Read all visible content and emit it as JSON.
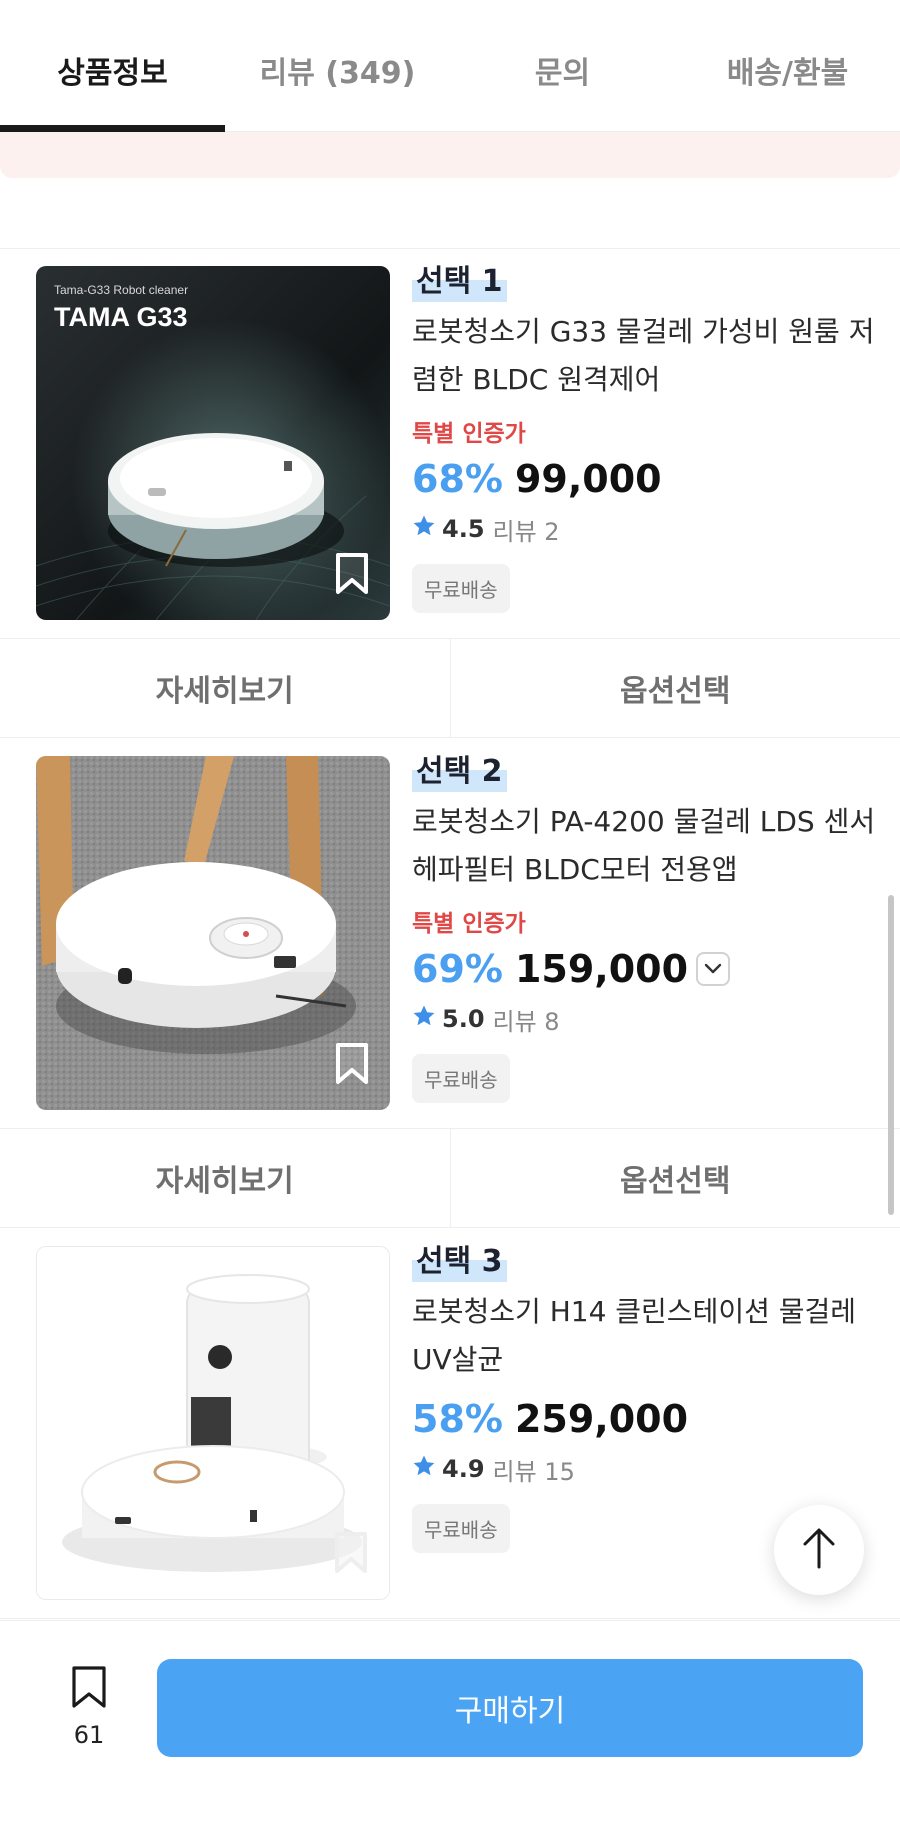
{
  "tabs": [
    {
      "label": "상품정보"
    },
    {
      "label": "리뷰 (349)"
    },
    {
      "label": "문의"
    },
    {
      "label": "배송/환불"
    }
  ],
  "products": [
    {
      "choice": "선택 1",
      "title": "로봇청소기 G33 물걸레 가성비 원룸 저렴한 BLDC 원격제어",
      "special": "특별 인증가",
      "discount": "68%",
      "price": "99,000",
      "rating": "4.5",
      "reviews": "리뷰 2",
      "badge": "무료배송",
      "image": {
        "caption_small": "Tama-G33 Robot cleaner",
        "caption_big": "TAMA G33"
      }
    },
    {
      "choice": "선택 2",
      "title": "로봇청소기 PA-4200 물걸레 LDS 센서 헤파필터 BLDC모터 전용앱",
      "special": "특별 인증가",
      "discount": "69%",
      "price": "159,000",
      "rating": "5.0",
      "reviews": "리뷰 8",
      "badge": "무료배송"
    },
    {
      "choice": "선택 3",
      "title": "로봇청소기 H14 클린스테이션 물걸레 UV살균",
      "discount": "58%",
      "price": "259,000",
      "rating": "4.9",
      "reviews": "리뷰 15",
      "badge": "무료배송"
    }
  ],
  "actions": {
    "detail": "자세히보기",
    "option": "옵션선택"
  },
  "bottom": {
    "bookmark_count": "61",
    "buy_label": "구매하기"
  },
  "colors": {
    "accent": "#4aa3f3",
    "discount": "#4a9ff0",
    "special": "#e04848",
    "star": "#3d8fe8"
  },
  "icons": [
    "bookmark-icon",
    "star-icon",
    "chevron-down-icon",
    "arrow-up-icon"
  ]
}
